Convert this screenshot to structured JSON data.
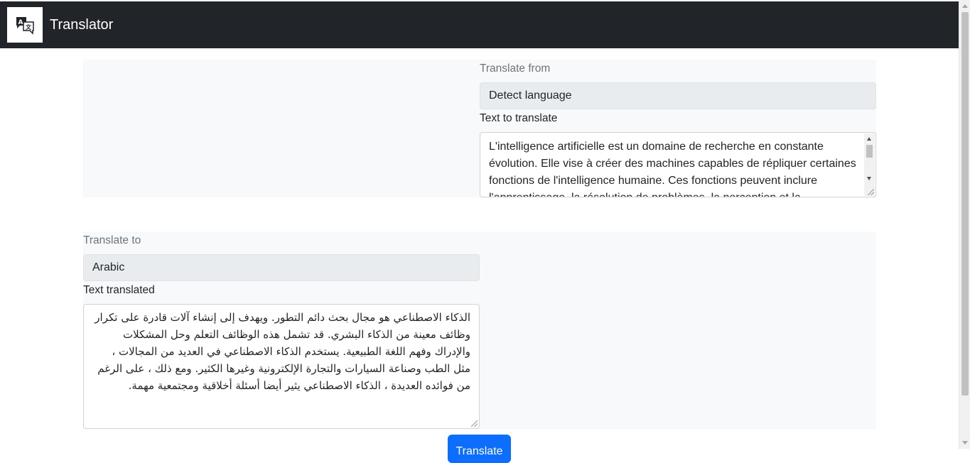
{
  "navbar": {
    "brand": "Translator",
    "logo_icon": "translate-icon"
  },
  "source": {
    "from_label": "Translate from",
    "from_language": "Detect language",
    "text_label": "Text to translate",
    "text": "L'intelligence artificielle est un domaine de recherche en constante évolution. Elle vise à créer des machines capables de répliquer certaines fonctions de l'intelligence humaine. Ces fonctions peuvent inclure l'apprentissage, la résolution de problèmes, la perception et la compréhension du langage naturel."
  },
  "target": {
    "to_label": "Translate to",
    "to_language": "Arabic",
    "text_label": "Text translated",
    "text": "الذكاء الاصطناعي هو مجال بحث دائم التطور. ويهدف إلى إنشاء آلات قادرة على تكرار وظائف معينة من الذكاء البشري. قد تشمل هذه الوظائف التعلم وحل المشكلات والإدراك وفهم اللغة الطبيعية. يستخدم الذكاء الاصطناعي في العديد من المجالات ، مثل الطب وصناعة السيارات والتجارة الإلكترونية وغيرها الكثير. ومع ذلك ، على الرغم من فوائده العديدة ، الذكاء الاصطناعي يثير أيضا أسئلة أخلاقية ومجتمعية مهمة."
  },
  "actions": {
    "translate_label": "Translate"
  }
}
